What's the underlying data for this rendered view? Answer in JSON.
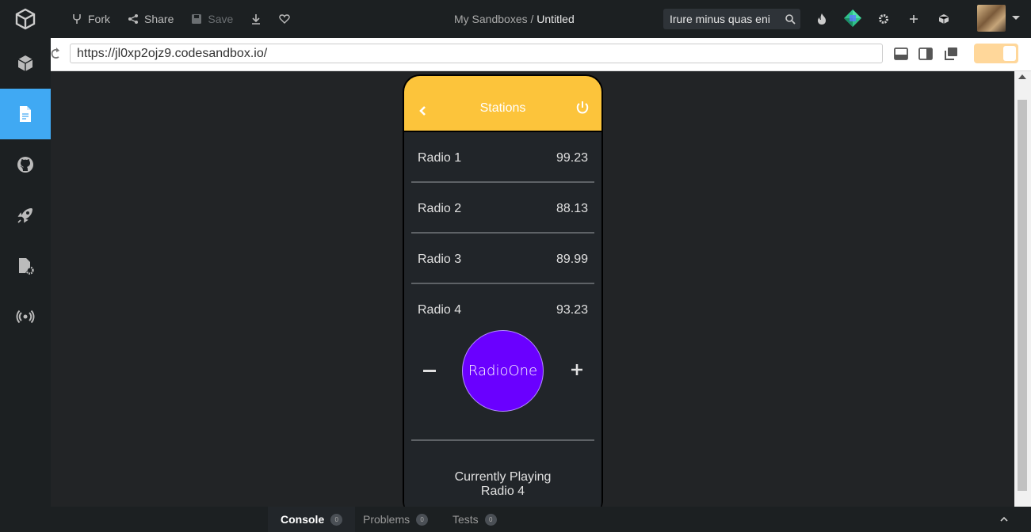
{
  "topbar": {
    "fork_label": "Fork",
    "share_label": "Share",
    "save_label": "Save",
    "breadcrumb_parent": "My Sandboxes",
    "breadcrumb_sep": "/",
    "breadcrumb_current": "Untitled",
    "search_value": "Irure minus quas eni"
  },
  "browser": {
    "url": "https://jl0xp2ojz9.codesandbox.io/"
  },
  "app": {
    "header_title": "Stations",
    "stations": [
      {
        "name": "Radio 1",
        "freq": "99.23"
      },
      {
        "name": "Radio 2",
        "freq": "88.13"
      },
      {
        "name": "Radio 3",
        "freq": "89.99"
      },
      {
        "name": "Radio 4",
        "freq": "93.23"
      }
    ],
    "disc_label": "RadioOne",
    "now_playing_label": "Currently Playing",
    "now_playing_station": "Radio 4"
  },
  "bottom_tabs": [
    {
      "label": "Console",
      "count": "0"
    },
    {
      "label": "Problems",
      "count": "0"
    },
    {
      "label": "Tests",
      "count": "0"
    }
  ],
  "colors": {
    "accent": "#40a9f3",
    "app_header": "#fcc43b",
    "disc": "#6a00ff"
  }
}
